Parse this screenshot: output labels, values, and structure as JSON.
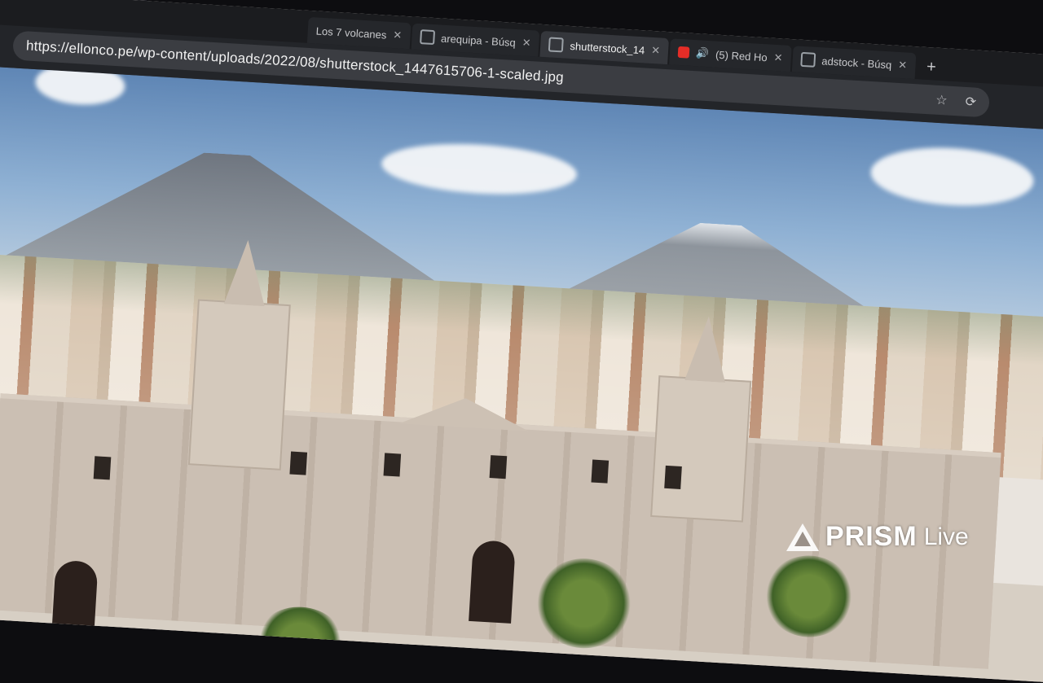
{
  "browser": {
    "tabs": [
      {
        "title": "Los 7 volcanes",
        "favicon": "search-icon"
      },
      {
        "title": "arequipa - Búsq",
        "favicon": "search-icon"
      },
      {
        "title": "shutterstock_14",
        "favicon": "globe-icon"
      },
      {
        "title": "(5) Red Ho",
        "favicon": "youtube-icon",
        "audio": true
      },
      {
        "title": "adstock - Búsq",
        "favicon": "search-icon"
      }
    ],
    "close_glyph": "✕",
    "newtab_glyph": "+",
    "url": "https://ellonco.pe/wp-content/uploads/2022/08/shutterstock_1447615706-1-scaled.jpg",
    "bookmark_icon": "☆",
    "share_icon": "⟳"
  },
  "watermark": {
    "brand": "PRISM",
    "suffix": "Live"
  },
  "colors": {
    "accent_youtube": "#e52d27",
    "chrome_bg": "#232529"
  }
}
